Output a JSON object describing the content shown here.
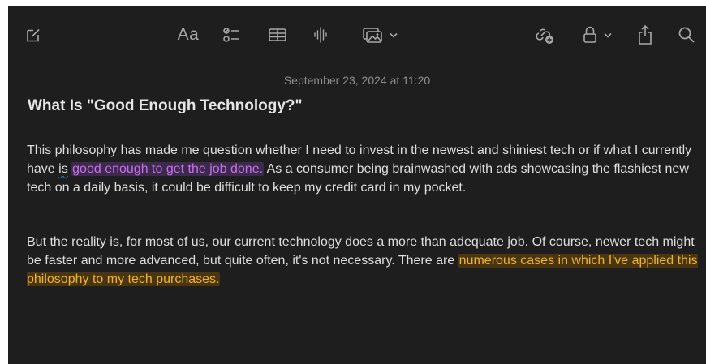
{
  "toolbar": {
    "compose": {
      "icon": "compose-icon"
    },
    "format": {
      "label": "Aa",
      "icon": "format-text-icon"
    },
    "checklist": {
      "icon": "checklist-icon"
    },
    "table": {
      "icon": "table-icon"
    },
    "audio": {
      "icon": "audio-waveform-icon"
    },
    "media": {
      "icon": "media-icon",
      "menu_icon": "chevron-down-icon"
    },
    "collaborate": {
      "icon": "collaborate-icon"
    },
    "lock": {
      "icon": "lock-icon",
      "menu_icon": "chevron-down-icon"
    },
    "share": {
      "icon": "share-icon"
    },
    "search": {
      "icon": "search-icon"
    }
  },
  "note": {
    "date": "September 23, 2024 at 11:20",
    "title": "What Is \"Good Enough Technology?\"",
    "p1": {
      "part1": "This philosophy has made me question whether I need to invest in the newest and shiniest tech or if what I currently have ",
      "misspelled": "is",
      "part2": " ",
      "highlight": "good enough to get the job done.",
      "part3": " As a consumer being brainwashed with ads showcasing the flashiest new tech on a daily basis, it could be difficult to keep my credit card in my pocket."
    },
    "p2": {
      "part1": "But the reality is, for most of us, our current technology does a more than adequate job. Of course, newer tech might be faster and more advanced, but quite often, it's not necessary. There are ",
      "highlight": "numerous cases in which I've applied this philosophy to my tech purchases."
    }
  },
  "colors": {
    "background": "#1e1e1e",
    "text": "#dedede",
    "highlight_purple": "#c46ff0",
    "highlight_orange": "#f0b429",
    "icon": "#a7a7a7"
  }
}
